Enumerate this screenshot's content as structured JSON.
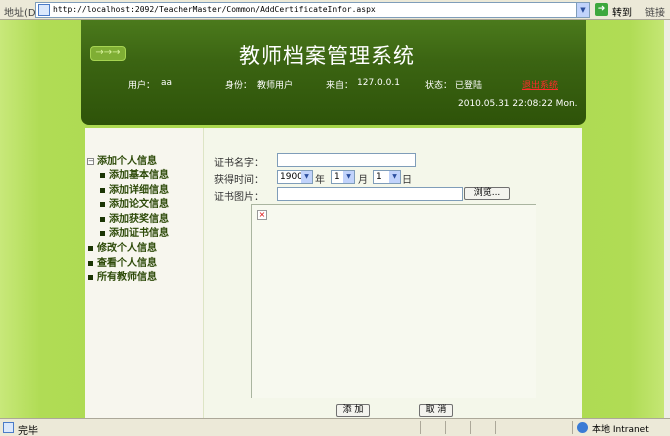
{
  "browser": {
    "address_label": "地址(D)",
    "url": "http://localhost:2092/TeacherMaster/Common/AddCertificateInfor.aspx",
    "go_label": "转到",
    "links_label": "链接"
  },
  "header": {
    "title": "教师档案管理系统",
    "user_label": "用户：",
    "user_value": "aa",
    "role_label": "身份：",
    "role_value": "教师用户",
    "from_label": "来自：",
    "from_value": "127.0.0.1",
    "state_label": "状态：",
    "state_value": "已登陆",
    "logout_label": "退出系统",
    "datetime": "2010.05.31  22:08:22  Mon."
  },
  "nav": {
    "group_title": "添加个人信息",
    "subitems": [
      "添加基本信息",
      "添加详细信息",
      "添加论文信息",
      "添加获奖信息",
      "添加证书信息"
    ],
    "items": [
      "修改个人信息",
      "查看个人信息",
      "所有教师信息"
    ]
  },
  "form": {
    "cert_name_label": "证书名字：",
    "cert_name_value": "",
    "date_label": "获得时间：",
    "year_value": "1900",
    "year_unit": "年",
    "month_value": "1",
    "month_unit": "月",
    "day_value": "1",
    "day_unit": "日",
    "image_label": "证书图片：",
    "browse_label": "浏览...",
    "broken_image_glyph": "×"
  },
  "buttons": {
    "add_label": "添 加",
    "cancel_label": "取 消"
  },
  "status": {
    "text": "完毕",
    "zone": "本地 Intranet"
  }
}
